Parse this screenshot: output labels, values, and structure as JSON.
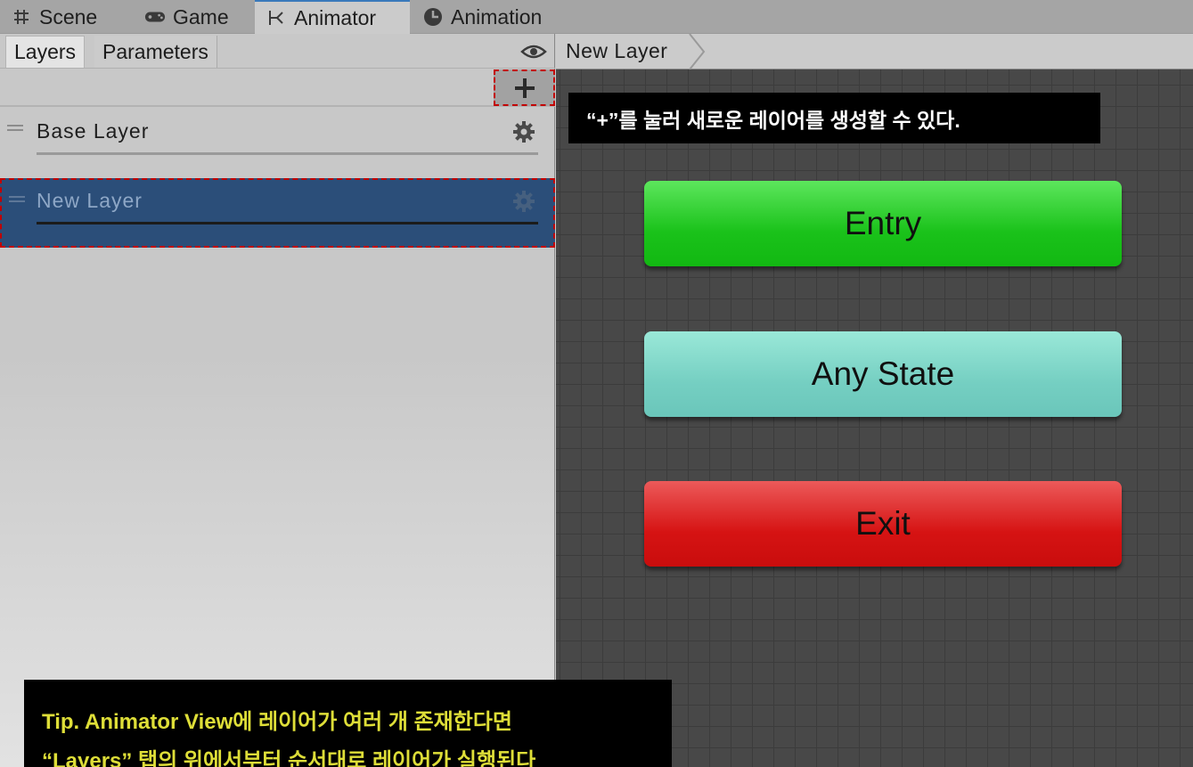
{
  "tabs": [
    {
      "label": "Scene",
      "icon": "scene-grid-icon"
    },
    {
      "label": "Game",
      "icon": "gamepad-icon"
    },
    {
      "label": "Animator",
      "icon": "animator-icon"
    },
    {
      "label": "Animation",
      "icon": "animation-clock-icon"
    }
  ],
  "active_tab": "Animator",
  "left_panel": {
    "subtabs": [
      "Layers",
      "Parameters"
    ],
    "active_subtab": "Layers",
    "add_button_label": "+",
    "layers": [
      {
        "name": "Base Layer",
        "selected": false
      },
      {
        "name": "New Layer",
        "selected": true
      }
    ]
  },
  "graph": {
    "breadcrumb": "New Layer",
    "tooltip": "“+”를 눌러 새로운 레이어를 생성할 수 있다.",
    "nodes": [
      {
        "label": "Entry",
        "color": "#1ec51e"
      },
      {
        "label": "Any State",
        "color": "#76cfc3"
      },
      {
        "label": "Exit",
        "color": "#d71616"
      }
    ]
  },
  "tip": {
    "line1": "Tip. Animator View에 레이어가 여러 개 존재한다면",
    "line2": "“Layers” 탭의 위에서부터 순서대로 레이어가 실행된다"
  },
  "colors": {
    "selection": "#2b4e79",
    "highlight_border": "#c20000",
    "tip_text": "#dede38"
  }
}
